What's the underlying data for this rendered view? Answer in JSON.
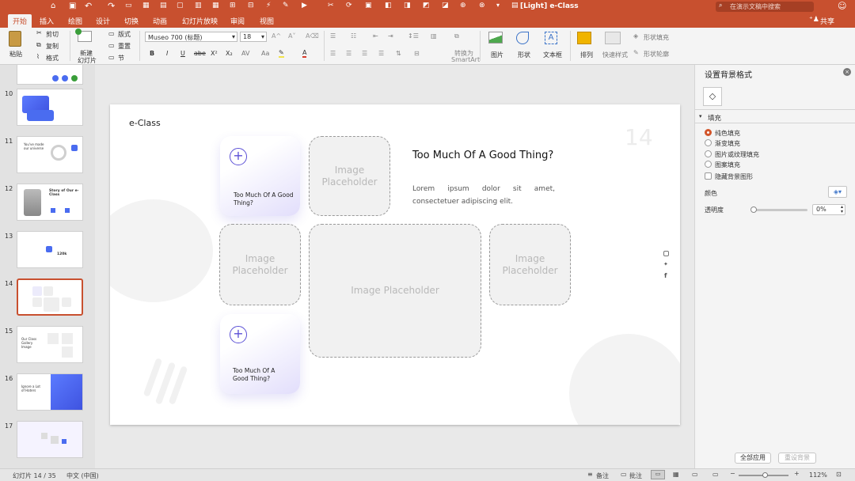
{
  "window": {
    "title": "[Light] e-Class",
    "search_placeholder": "在演示文稿中搜索",
    "share_label": "共享"
  },
  "tabs": [
    "开始",
    "插入",
    "绘图",
    "设计",
    "切换",
    "动画",
    "幻灯片放映",
    "审阅",
    "视图"
  ],
  "ribbon": {
    "paste": "粘贴",
    "cut": "剪切",
    "copy": "复制",
    "format": "格式",
    "new_slide": [
      "新建",
      "幻灯片"
    ],
    "layout": "版式",
    "reset": "重置",
    "section": "节",
    "font_name": "Museo 700 (标题)",
    "font_size": "18",
    "format_buttons": [
      "B",
      "I",
      "U",
      "abe",
      "X²",
      "X₂"
    ],
    "convert_smartart": [
      "转换为",
      "SmartArt"
    ],
    "picture": "图片",
    "shape": "形状",
    "textbox": "文本框",
    "arrange": "排列",
    "quick_styles": "快速样式",
    "shape_fill": "形状填充",
    "shape_outline": "形状轮廓"
  },
  "slides": [
    {
      "number": "10"
    },
    {
      "number": "11",
      "text": "You've made our universe"
    },
    {
      "number": "12",
      "text": "Story of Our e-Class"
    },
    {
      "number": "13",
      "text": "120k"
    },
    {
      "number": "14"
    },
    {
      "number": "15",
      "text": "Our Class Gallery Image"
    },
    {
      "number": "16",
      "text": "Ignore a Lot of Haters"
    },
    {
      "number": "17"
    }
  ],
  "slide": {
    "brand": "e-Class",
    "page_number": "14",
    "card_top_title": "Too Much Of A Good Thing?",
    "card_bottom_title": "Too Much Of A Good Thing?",
    "heading": "Too Much Of A Good Thing?",
    "body": "Lorem ipsum dolor sit amet, consectetuer adipiscing elit.",
    "placeholder_text": "Image Placeholder",
    "accent": "#5b50d6",
    "social_icons": [
      "instagram-icon",
      "twitter-icon",
      "facebook-icon"
    ]
  },
  "pane": {
    "title": "设置背景格式",
    "section": "填充",
    "options": [
      "纯色填充",
      "渐变填充",
      "图片或纹理填充",
      "图案填充"
    ],
    "selected_option": "纯色填充",
    "hide_bg": "隐藏背景图形",
    "color_label": "颜色",
    "transparency_label": "透明度",
    "transparency_value": "0%",
    "apply_all": "全部应用",
    "reset_bg": "重设背景"
  },
  "status": {
    "slide_info": "幻灯片 14 / 35",
    "language": "中文 (中国)",
    "notes": "备注",
    "comments": "批注",
    "zoom": "112%"
  },
  "colors": {
    "brand": "#c8502f",
    "accent": "#5b50d6"
  }
}
